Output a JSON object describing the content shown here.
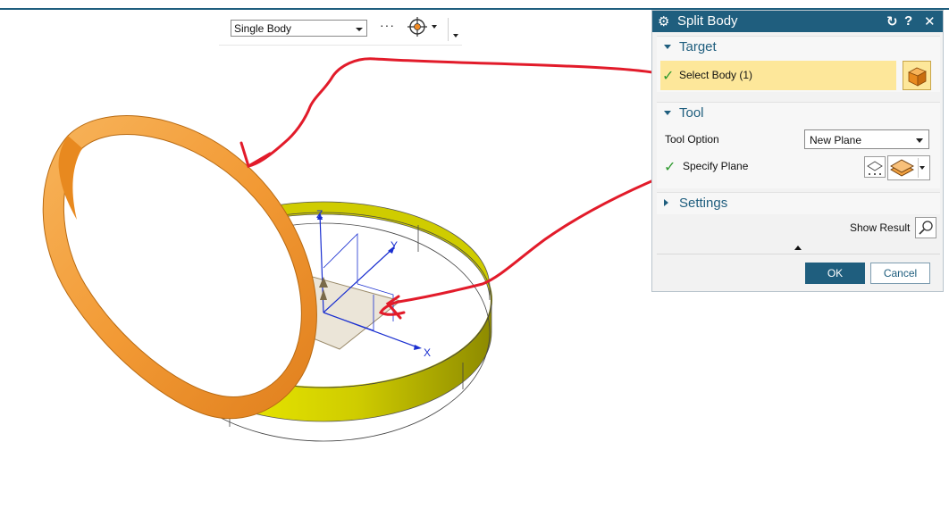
{
  "toolbar": {
    "filter_value": "Single Body",
    "more_label": "···"
  },
  "dialog": {
    "title": "Split Body",
    "target": {
      "title": "Target",
      "select_body_label": "Select Body (1)"
    },
    "tool": {
      "title": "Tool",
      "tool_option_label": "Tool Option",
      "tool_option_value": "New Plane",
      "specify_plane_label": "Specify Plane"
    },
    "settings": {
      "title": "Settings"
    },
    "show_result_label": "Show Result",
    "ok_label": "OK",
    "cancel_label": "Cancel"
  },
  "viewport": {
    "axis_labels": {
      "x": "X",
      "y": "Y",
      "z": "Z"
    }
  },
  "colors": {
    "header": "#1f5e7e",
    "highlight": "#fde79a",
    "ring_orange": "#f5a347",
    "ring_yellow": "#d6d400",
    "annotation": "#e21b2a",
    "check": "#2f9a2f"
  }
}
